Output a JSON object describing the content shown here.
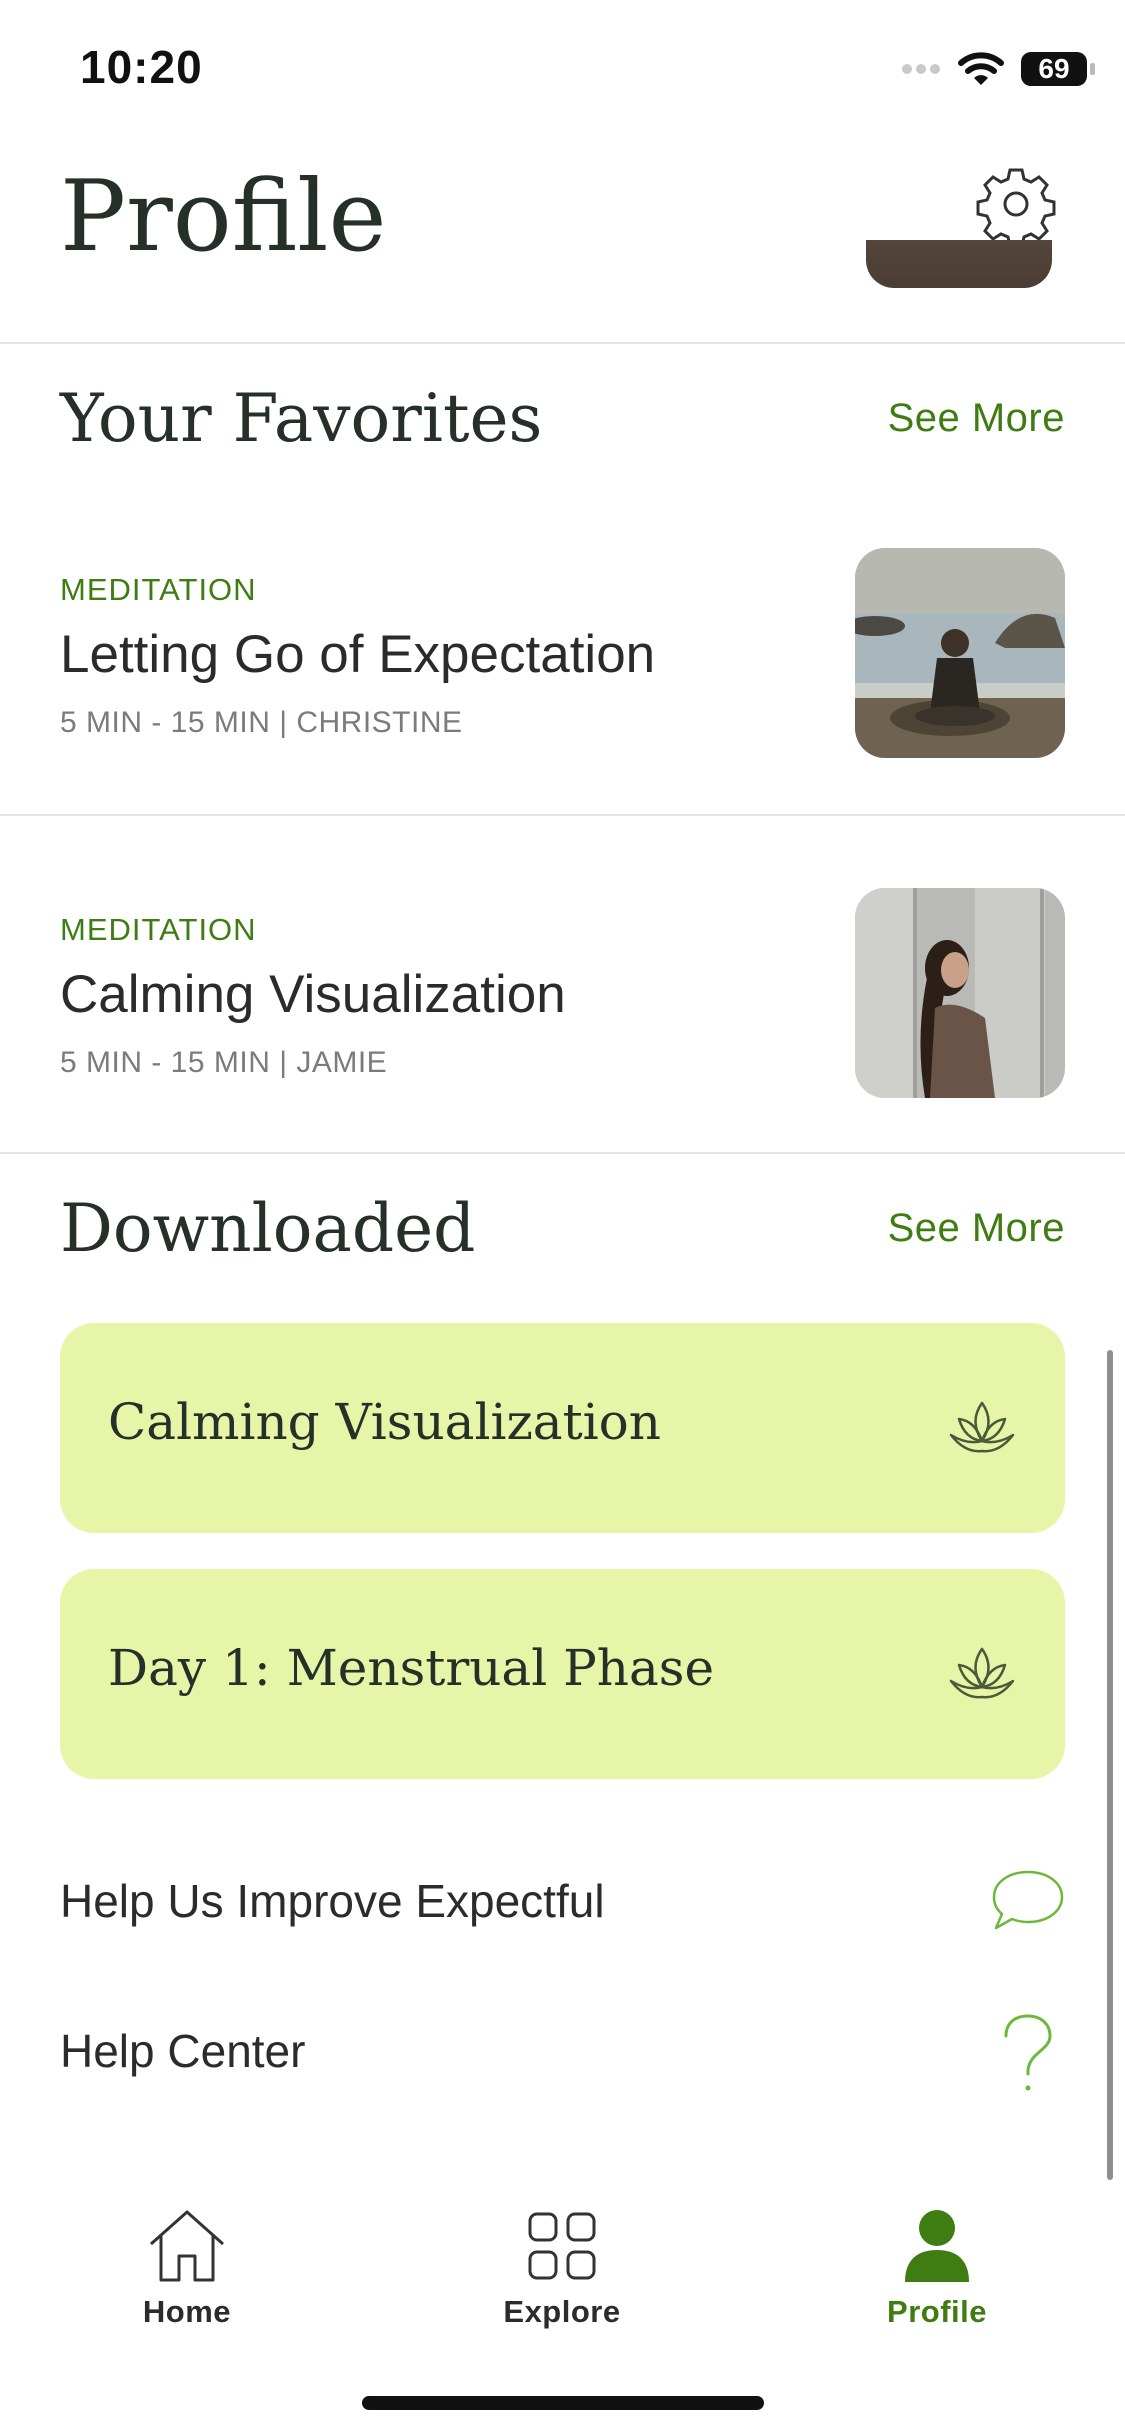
{
  "status_bar": {
    "time": "10:20",
    "battery": "69"
  },
  "header": {
    "title": "Profile"
  },
  "favorites": {
    "title": "Your Favorites",
    "see_more": "See More",
    "items": [
      {
        "category": "MEDITATION",
        "title": "Letting Go of Expectation",
        "meta": "5 MIN - 15 MIN | CHRISTINE"
      },
      {
        "category": "MEDITATION",
        "title": "Calming Visualization",
        "meta": "5 MIN - 15 MIN | JAMIE"
      }
    ]
  },
  "downloaded": {
    "title": "Downloaded",
    "see_more": "See More",
    "items": [
      {
        "title": "Calming Visualization"
      },
      {
        "title": "Day 1: Menstrual Phase"
      }
    ]
  },
  "help": {
    "improve": "Help Us Improve Expectful",
    "center": "Help Center"
  },
  "tabs": [
    {
      "label": "Home"
    },
    {
      "label": "Explore"
    },
    {
      "label": "Profile"
    }
  ],
  "colors": {
    "accent": "#3f7d12",
    "card": "#e6f5a7",
    "title": "#253029"
  },
  "icons": [
    "gear-icon",
    "lotus-icon",
    "chat-bubble-icon",
    "question-icon",
    "home-icon",
    "explore-grid-icon",
    "person-icon",
    "wifi-icon",
    "battery-icon"
  ]
}
